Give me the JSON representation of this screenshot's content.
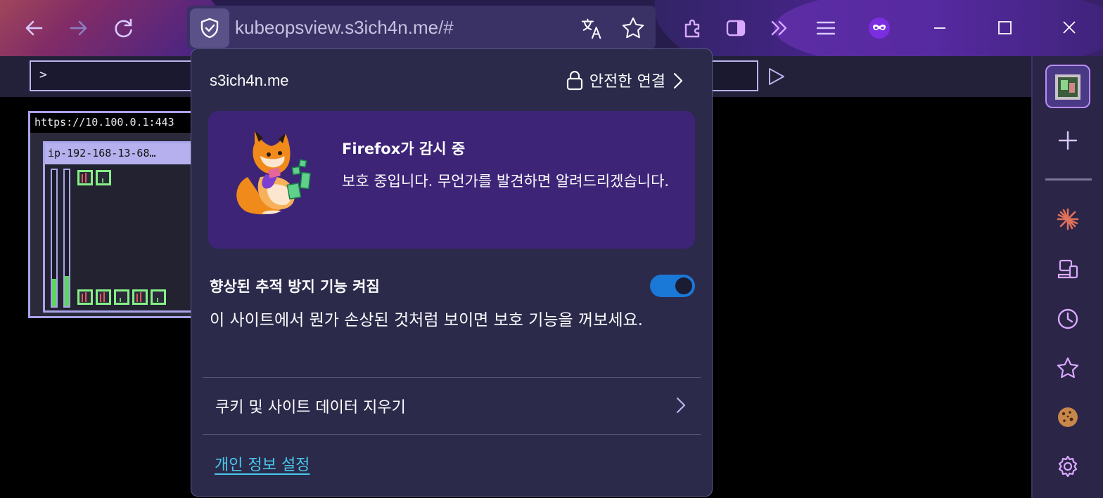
{
  "browser": {
    "url_domain": "kubeopsview.s3ich4n.me",
    "url_rest": "/#",
    "nav_icons": [
      "back-arrow-icon",
      "forward-arrow-icon",
      "reload-icon"
    ],
    "url_icons": [
      "translate-icon",
      "bookmark-star-icon"
    ],
    "toolbar_icons": [
      "extensions-icon",
      "sidebar-toggle-icon",
      "overflow-chevron-icon",
      "menu-hamburger-icon",
      "private-mask-icon"
    ],
    "window_icons": [
      "minimize-icon",
      "maximize-icon",
      "close-icon"
    ]
  },
  "page": {
    "command_prompt": ">",
    "cluster_title": "https://10.100.0.1:443",
    "node_title": "ip-192-168-13-68…"
  },
  "sidebar": {
    "icons": [
      "active-tab-thumbnail-icon",
      "add-icon",
      "ai-sparkle-icon",
      "synced-devices-icon",
      "history-icon",
      "bookmarks-star-icon",
      "cookie-icon",
      "settings-gear-icon"
    ]
  },
  "panel": {
    "domain": "s3ich4n.me",
    "secure_connection": "안전한 연결",
    "card_title": "Firefox가 감시 중",
    "card_text": "보호 중입니다. 무언가를 발견하면 알려드리겠습니다.",
    "etp_title": "향상된 추적 방지 기능 켜짐",
    "etp_enabled": true,
    "etp_desc": "이 사이트에서 뭔가 손상된 것처럼 보이면 보호 기능을 꺼보세요.",
    "clear_data": "쿠키 및 사이트 데이터 지우기",
    "privacy_settings": "개인 정보 설정"
  },
  "colors": {
    "panel_bg": "#2b2a4a",
    "card_bg": "#3d2477",
    "toggle_on": "#1a78d6",
    "link": "#48c8ec",
    "accent_purple": "#b98cf7"
  }
}
